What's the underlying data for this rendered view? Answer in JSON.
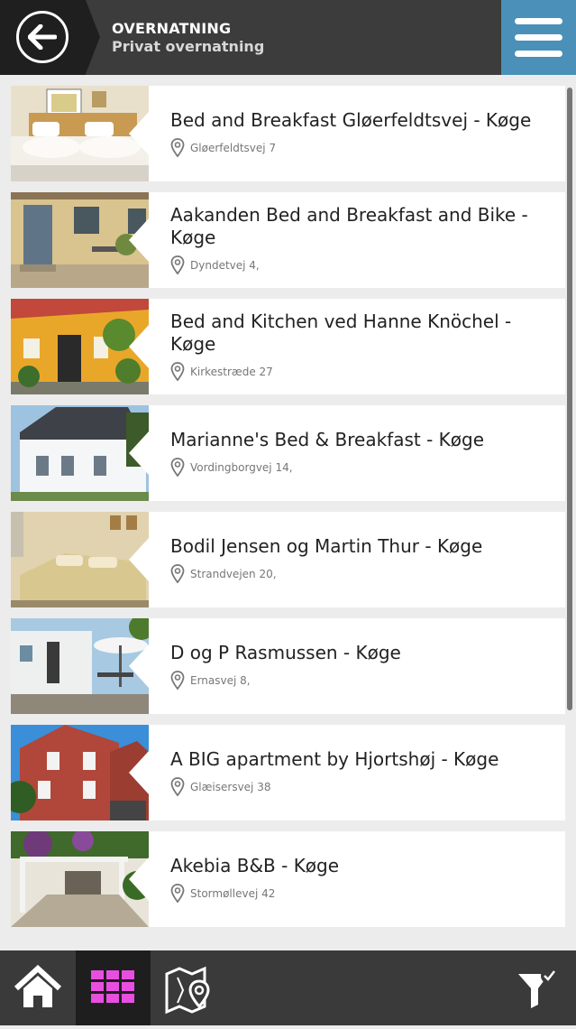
{
  "header": {
    "title": "OVERNATNING",
    "subtitle": "Privat overnatning",
    "back_icon": "arrow-left-icon",
    "menu_icon": "hamburger-menu-icon"
  },
  "listings": [
    {
      "name": "Bed and Breakfast Gløerfeldtsvej - Køge",
      "address": "Gløerfeldtsvej 7"
    },
    {
      "name": "Aakanden Bed and Breakfast and Bike - Køge",
      "address": "Dyndetvej 4,"
    },
    {
      "name": "Bed and Kitchen ved Hanne Knöchel - Køge",
      "address": "Kirkestræde 27"
    },
    {
      "name": "Marianne's Bed & Breakfast - Køge",
      "address": "Vordingborgvej 14,"
    },
    {
      "name": "Bodil Jensen og Martin Thur - Køge",
      "address": "Strandvejen 20,"
    },
    {
      "name": "D og P Rasmussen - Køge",
      "address": "Ernasvej 8,"
    },
    {
      "name": "A BIG apartment by Hjortshøj - Køge",
      "address": "Glæisersvej 38"
    },
    {
      "name": "Akebia B&B - Køge",
      "address": "Stormøllevej 42"
    }
  ],
  "footer": {
    "home_icon": "home-icon",
    "grid_icon": "grid-icon",
    "map_icon": "map-pin-icon",
    "filter_icon": "filter-check-icon",
    "active_color": "#e84fe0"
  },
  "colors": {
    "header_bg": "#3c3c3c",
    "menu_bg": "#4a90b8",
    "footer_bg": "#3a3a3a"
  }
}
